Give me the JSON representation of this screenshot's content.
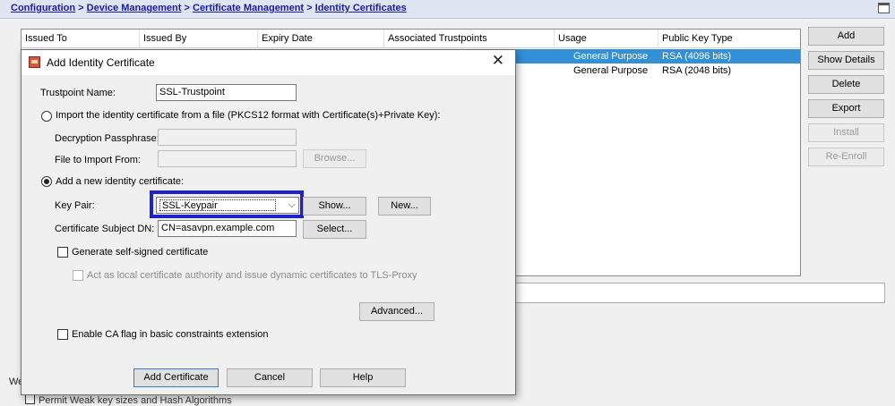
{
  "breadcrumb": {
    "items": [
      "Configuration",
      "Device Management",
      "Certificate Management"
    ],
    "current": "Identity Certificates",
    "separator": ">"
  },
  "table": {
    "columns": [
      "Issued To",
      "Issued By",
      "Expiry Date",
      "Associated Trustpoints",
      "Usage",
      "Public Key Type"
    ],
    "rows": [
      {
        "usage": "General Purpose",
        "key_type": "RSA (4096 bits)",
        "selected": true
      },
      {
        "usage": "General Purpose",
        "key_type": "RSA (2048 bits)",
        "selected": false
      }
    ]
  },
  "side_buttons": {
    "add": "Add",
    "show_details": "Show Details",
    "delete": "Delete",
    "export": "Export",
    "install": "Install",
    "reenroll": "Re-Enroll"
  },
  "background": {
    "left_fragment": "We",
    "bottom_checkbox_label": "Permit Weak key sizes and Hash Algorithms"
  },
  "dialog": {
    "title": "Add Identity Certificate",
    "trustpoint_label": "Trustpoint Name:",
    "trustpoint_value": "SSL-Trustpoint",
    "import_radio_label": "Import the identity certificate from a file (PKCS12 format with Certificate(s)+Private Key):",
    "passphrase_label": "Decryption Passphrase:",
    "file_label": "File to Import From:",
    "browse_label": "Browse...",
    "add_new_radio_label": "Add a new identity certificate:",
    "key_pair_label": "Key Pair:",
    "key_pair_value": "SSL-Keypair",
    "show_label": "Show...",
    "new_label": "New...",
    "subject_dn_label": "Certificate Subject DN:",
    "subject_dn_value": "CN=asavpn.example.com",
    "select_label": "Select...",
    "self_signed_label": "Generate self-signed certificate",
    "local_ca_label": "Act as local certificate authority and issue dynamic certificates to TLS-Proxy",
    "advanced_label": "Advanced...",
    "ca_flag_label": "Enable CA flag in basic constraints extension",
    "add_cert_label": "Add Certificate",
    "cancel_label": "Cancel",
    "help_label": "Help"
  },
  "colors": {
    "highlight_border": "#1f22cc",
    "selected_row": "#3390d6",
    "breadcrumb_link": "#1a1aa6"
  }
}
